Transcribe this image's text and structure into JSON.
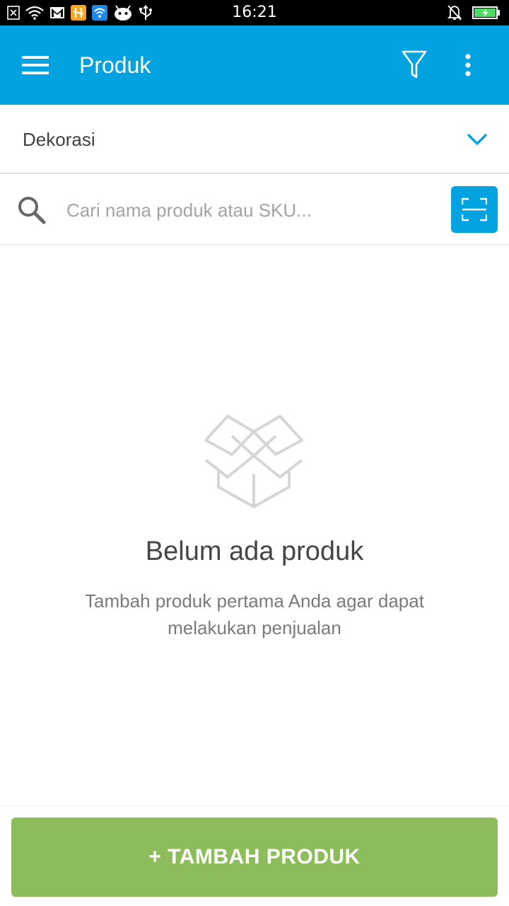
{
  "status_bar": {
    "time": "16:21",
    "left_icons": [
      "notification-x-icon",
      "wifi-icon",
      "gmail-icon",
      "tools-app-icon",
      "wifi-app-icon",
      "android-icon",
      "usb-icon"
    ],
    "right_icons": [
      "bell-off-icon",
      "battery-charging-icon"
    ]
  },
  "app_bar": {
    "title": "Produk",
    "menu_icon": "hamburger-menu-icon",
    "filter_icon": "filter-icon",
    "more_icon": "more-vertical-icon"
  },
  "category": {
    "selected": "Dekorasi",
    "icon": "chevron-down-icon"
  },
  "search": {
    "placeholder": "Cari nama produk atau SKU...",
    "value": "",
    "icon": "search-icon",
    "scan_icon": "barcode-scan-icon"
  },
  "empty_state": {
    "icon": "open-box-icon",
    "title": "Belum ada produk",
    "subtitle": "Tambah produk pertama Anda agar dapat melakukan penjualan"
  },
  "actions": {
    "add_product_label": "+ TAMBAH PRODUK"
  },
  "colors": {
    "primary": "#00a3e0",
    "add_button": "#8cbd5a",
    "status_bar": "#000000"
  }
}
